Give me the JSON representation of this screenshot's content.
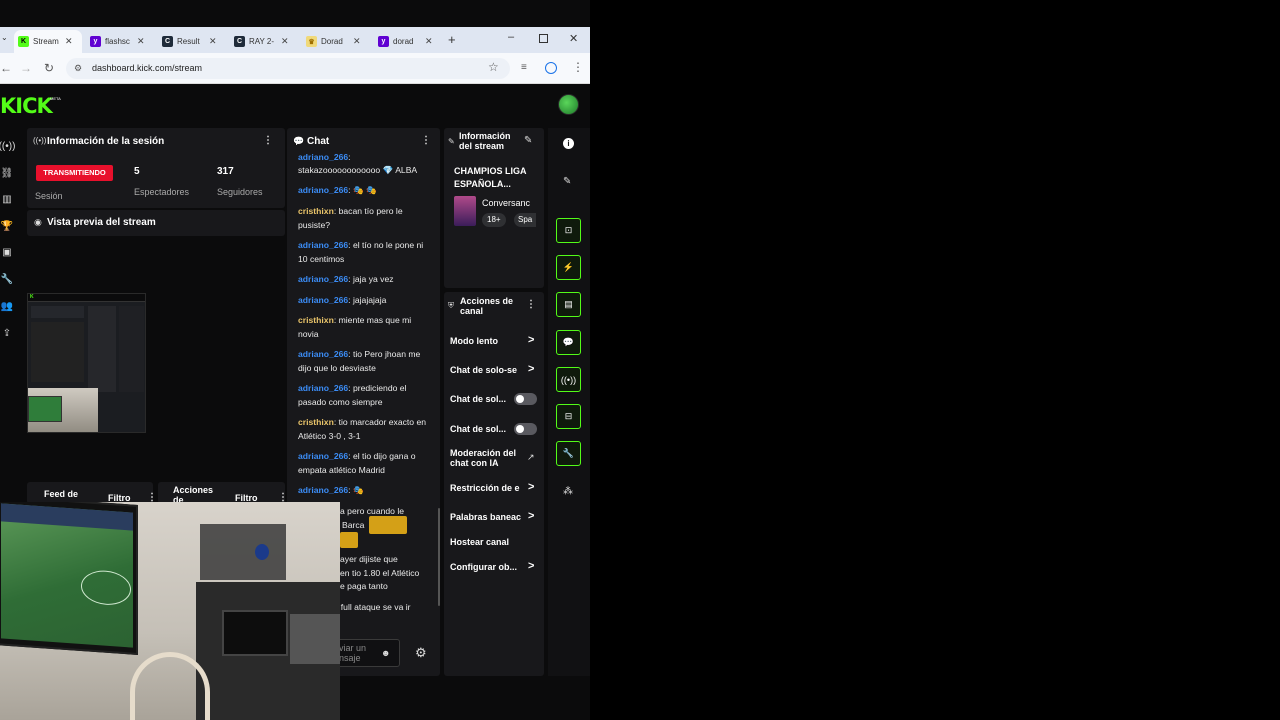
{
  "browser": {
    "tabs": [
      {
        "label": "Stream",
        "favicon": "kick-favicon",
        "color": "#53fc18",
        "glyph": "K",
        "active": true
      },
      {
        "label": "flashsc",
        "favicon": "yahoo-favicon",
        "color": "#6001d2",
        "glyph": "y"
      },
      {
        "label": "Result",
        "favicon": "c-favicon",
        "color": "#1f2b3a",
        "glyph": "C"
      },
      {
        "label": "RAY 2-",
        "favicon": "c-favicon",
        "color": "#1f2b3a",
        "glyph": "C"
      },
      {
        "label": "Dorad",
        "favicon": "trophy-favicon",
        "color": "#d9a400",
        "glyph": "🏆"
      },
      {
        "label": "dorad",
        "favicon": "yahoo-favicon",
        "color": "#6001d2",
        "glyph": "y"
      }
    ],
    "url": "dashboard.kick.com/stream"
  },
  "header": {
    "logo": "KICK",
    "logo_tag": "META"
  },
  "session": {
    "title": "Información de la sesión",
    "status_badge": "TRANSMITIENDO",
    "status_label": "Sesión",
    "viewers_value": "5",
    "viewers_label": "Espectadores",
    "followers_value": "317",
    "followers_label": "Seguidores"
  },
  "preview": {
    "title": "Vista previa del stream"
  },
  "bottom_panels": {
    "feed_title": "Feed de",
    "feed_filter": "Filtro",
    "actions_title": "Acciones",
    "actions_title2": "de",
    "actions_filter": "Filtro"
  },
  "chat": {
    "title": "Chat",
    "messages": [
      {
        "user": "adriano_266",
        "text": ": ",
        "color": "blue"
      },
      {
        "user": "",
        "text": "stakazoooooooooooo 💎 ALBA",
        "color": "blue"
      },
      {
        "user": "adriano_266",
        "text": ": 🎭 🎭",
        "color": "blue"
      },
      {
        "user": "cristhixn",
        "text": ": bacan tío pero le pusiste?",
        "color": "gold"
      },
      {
        "user": "adriano_266",
        "text": ": el tío no le pone ni 10 centimos",
        "color": "blue"
      },
      {
        "user": "adriano_266",
        "text": ": jaja ya vez",
        "color": "blue"
      },
      {
        "user": "adriano_266",
        "text": ": jajajajaja",
        "color": "blue"
      },
      {
        "user": "cristhixn",
        "text": ": miente mas que mi novia",
        "color": "gold"
      },
      {
        "user": "adriano_266",
        "text": ": tio Pero jhoan me dijo que lo desviaste",
        "color": "blue"
      },
      {
        "user": "adriano_266",
        "text": ": prediciendo el pasado como siempre",
        "color": "blue"
      },
      {
        "user": "cristhixn",
        "text": ": tio marcador exacto en Atlético 3-0 , 3-1",
        "color": "gold"
      },
      {
        "user": "adriano_266",
        "text": ": el tio dijo gana o empata atlético Madrid",
        "color": "blue"
      },
      {
        "user": "adriano_266",
        "text": ": 🎭",
        "color": "blue"
      }
    ],
    "partial_messages": [
      "a pero cuando le",
      "Barca",
      "ayer dijiste que",
      "en tio 1.80 el Atlético",
      "e paga tanto",
      ": full ataque se va ir"
    ],
    "input_placeholder_line1": "viar un",
    "input_placeholder_line2": "nsaje"
  },
  "stream_info": {
    "title_line1": "Información",
    "title_line2": "del stream",
    "stream_title_line1": "CHAMPIOS LIGA",
    "stream_title_line2": "ESPAÑOLA...",
    "category": "Conversanc",
    "tag_age": "18+",
    "tag_lang": "Spa"
  },
  "channel_actions": {
    "title_line1": "Acciones de",
    "title_line2": "canal",
    "items": [
      {
        "label": "Modo lento",
        "control": "chevron"
      },
      {
        "label": "Chat de solo-se",
        "control": "chevron"
      },
      {
        "label": "Chat de sol...",
        "control": "toggle"
      },
      {
        "label": "Chat de sol...",
        "control": "toggle"
      },
      {
        "label": "Moderación del",
        "label2": "chat con IA",
        "control": "external"
      },
      {
        "label": "Restricción de e",
        "control": "chevron"
      },
      {
        "label": "Palabras baneac",
        "control": "chevron"
      },
      {
        "label": "Hostear canal",
        "control": "none"
      },
      {
        "label": "Configurar ob...",
        "control": "chevron"
      }
    ]
  },
  "colors": {
    "accent": "#53fc18",
    "live": "#e8102c",
    "username_blue": "#3b8cf5",
    "username_gold": "#e9c46a"
  }
}
